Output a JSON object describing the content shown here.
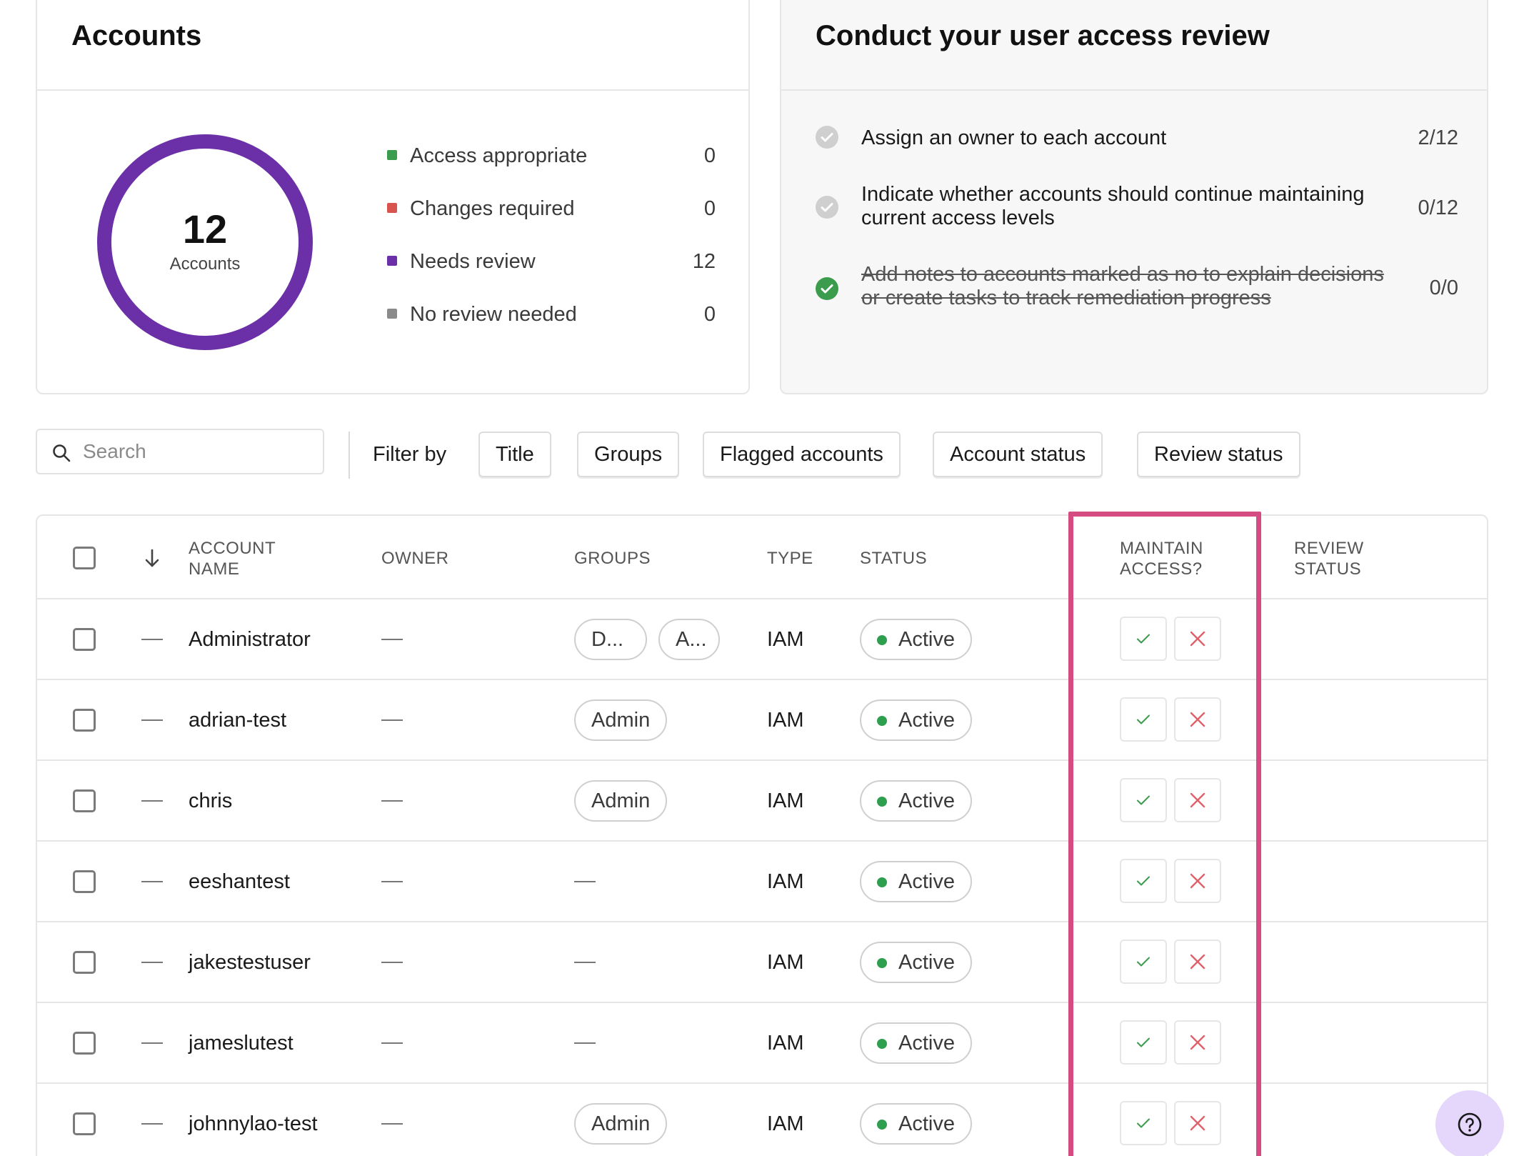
{
  "summary": {
    "title": "Accounts",
    "total": "12",
    "total_caption": "Accounts",
    "legend": [
      {
        "label": "Access appropriate",
        "count": "0",
        "color": "#3a9c4c"
      },
      {
        "label": "Changes required",
        "count": "0",
        "color": "#d9534f"
      },
      {
        "label": "Needs review",
        "count": "12",
        "color": "#6b2fa8"
      },
      {
        "label": "No review needed",
        "count": "0",
        "color": "#8a8a8a"
      }
    ]
  },
  "review": {
    "title": "Conduct your user access review",
    "tasks": [
      {
        "text": "Assign an owner to each account",
        "count": "2/12",
        "done": false
      },
      {
        "text": "Indicate whether accounts should continue maintaining current access levels",
        "count": "0/12",
        "done": false
      },
      {
        "text": "Add notes to accounts marked as no to explain decisions or create tasks to track remediation progress",
        "count": "0/0",
        "done": true
      }
    ]
  },
  "filters": {
    "search_placeholder": "Search",
    "filter_by_label": "Filter by",
    "buttons": [
      "Title",
      "Groups",
      "Flagged accounts",
      "Account status",
      "Review status"
    ]
  },
  "table": {
    "columns": {
      "account_name": "ACCOUNT NAME",
      "owner": "OWNER",
      "groups": "GROUPS",
      "type": "TYPE",
      "status": "STATUS",
      "maintain_access": "MAINTAIN ACCESS?",
      "review_status": "REVIEW STATUS"
    },
    "rows": [
      {
        "name": "Administrator",
        "groups": [
          "D...",
          "A..."
        ],
        "type": "IAM",
        "status": "Active"
      },
      {
        "name": "adrian-test",
        "groups": [
          "Admin"
        ],
        "type": "IAM",
        "status": "Active"
      },
      {
        "name": "chris",
        "groups": [
          "Admin"
        ],
        "type": "IAM",
        "status": "Active"
      },
      {
        "name": "eeshantest",
        "groups": [],
        "type": "IAM",
        "status": "Active"
      },
      {
        "name": "jakestestuser",
        "groups": [],
        "type": "IAM",
        "status": "Active"
      },
      {
        "name": "jameslutest",
        "groups": [],
        "type": "IAM",
        "status": "Active"
      },
      {
        "name": "johnnylao-test",
        "groups": [
          "Admin"
        ],
        "type": "IAM",
        "status": "Active"
      }
    ]
  },
  "colors": {
    "donut": "#6b2fa8",
    "highlight": "#d44c82",
    "status_active": "#2e9e4f",
    "approve": "#3a9c4c",
    "reject": "#e0606a"
  },
  "icons": {
    "search": "search-icon",
    "sort": "arrow-down-icon",
    "approve": "check-icon",
    "reject": "close-icon",
    "help": "question-circle-icon"
  }
}
